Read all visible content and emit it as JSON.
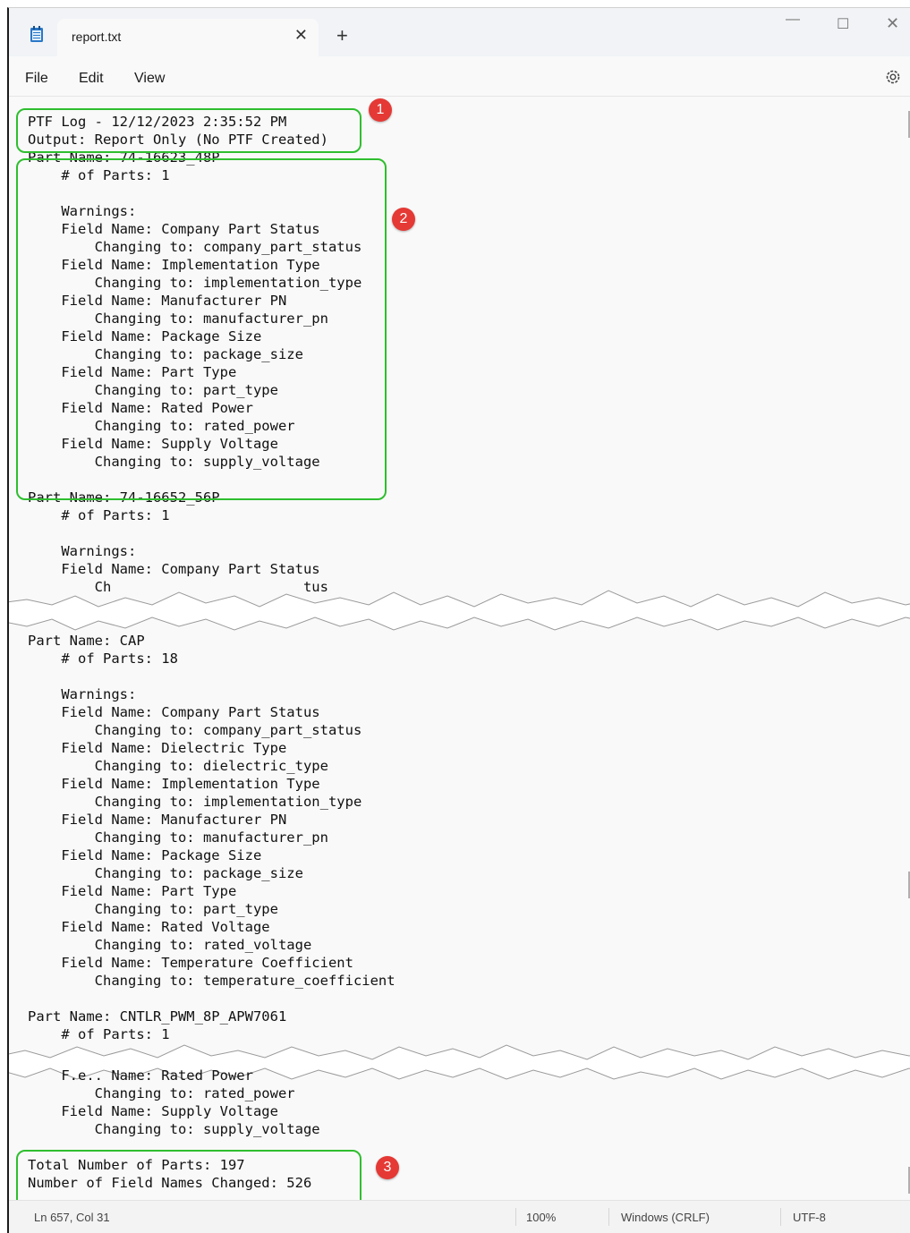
{
  "tab": {
    "title": "report.txt"
  },
  "menu": {
    "file": "File",
    "edit": "Edit",
    "view": "View"
  },
  "editor": {
    "lines_a": [
      "PTF Log - 12/12/2023 2:35:52 PM",
      "Output: Report Only (No PTF Created)",
      "Part Name: 74-16623_48P",
      "    # of Parts: 1",
      "",
      "    Warnings:",
      "    Field Name: Company Part Status",
      "        Changing to: company_part_status",
      "    Field Name: Implementation Type",
      "        Changing to: implementation_type",
      "    Field Name: Manufacturer PN",
      "        Changing to: manufacturer_pn",
      "    Field Name: Package Size",
      "        Changing to: package_size",
      "    Field Name: Part Type",
      "        Changing to: part_type",
      "    Field Name: Rated Power",
      "        Changing to: rated_power",
      "    Field Name: Supply Voltage",
      "        Changing to: supply_voltage",
      "",
      "Part Name: 74-16652_56P",
      "    # of Parts: 1",
      "",
      "    Warnings:",
      "    Field Name: Company Part Status",
      "        Ch                       tus"
    ],
    "lines_b": [
      "Part Name: CAP",
      "    # of Parts: 18",
      "",
      "    Warnings:",
      "    Field Name: Company Part Status",
      "        Changing to: company_part_status",
      "    Field Name: Dielectric Type",
      "        Changing to: dielectric_type",
      "    Field Name: Implementation Type",
      "        Changing to: implementation_type",
      "    Field Name: Manufacturer PN",
      "        Changing to: manufacturer_pn",
      "    Field Name: Package Size",
      "        Changing to: package_size",
      "    Field Name: Part Type",
      "        Changing to: part_type",
      "    Field Name: Rated Voltage",
      "        Changing to: rated_voltage",
      "    Field Name: Temperature Coefficient",
      "        Changing to: temperature_coefficient",
      "",
      "Part Name: CNTLR_PWM_8P_APW7061",
      "    # of Parts: 1"
    ],
    "lines_c": [
      "    F.e.. Name: Rated Power",
      "        Changing to: rated_power",
      "    Field Name: Supply Voltage",
      "        Changing to: supply_voltage",
      "",
      "Total Number of Parts: 197",
      "Number of Field Names Changed: 526"
    ]
  },
  "annotations": {
    "badge1": "1",
    "badge2": "2",
    "badge3": "3",
    "box_color": "#2fbe2f",
    "badge_color": "#e53935"
  },
  "status": {
    "position": "Ln 657, Col 31",
    "zoom": "100%",
    "line_ending": "Windows (CRLF)",
    "encoding": "UTF-8"
  }
}
